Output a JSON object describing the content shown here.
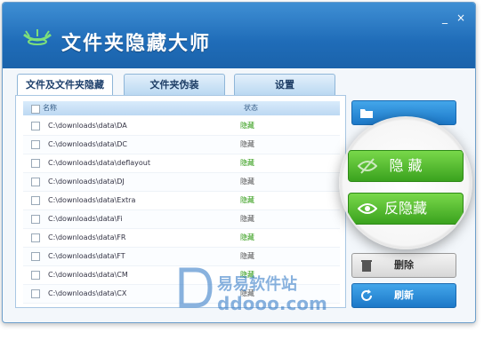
{
  "app": {
    "title": "文件夹隐藏大师",
    "minimize": "_",
    "close": "×"
  },
  "tabs": [
    "文件及文件夹隐藏",
    "文件夹伪装",
    "设置"
  ],
  "list": {
    "header": {
      "name": "名称",
      "status": "状态"
    },
    "rows": [
      {
        "path": "C:\\downloads\\data\\DA",
        "status": "隐藏"
      },
      {
        "path": "C:\\downloads\\data\\DC",
        "status": "隐藏"
      },
      {
        "path": "C:\\downloads\\data\\deflayout",
        "status": "隐藏"
      },
      {
        "path": "C:\\downloads\\data\\DJ",
        "status": "隐藏"
      },
      {
        "path": "C:\\downloads\\data\\Extra",
        "status": "隐藏"
      },
      {
        "path": "C:\\downloads\\data\\Fi",
        "status": "隐藏"
      },
      {
        "path": "C:\\downloads\\data\\FR",
        "status": "隐藏"
      },
      {
        "path": "C:\\downloads\\data\\FT",
        "status": "隐藏"
      },
      {
        "path": "C:\\downloads\\data\\CM",
        "status": "隐藏"
      },
      {
        "path": "C:\\downloads\\data\\CX",
        "status": "隐藏"
      }
    ]
  },
  "buttons": {
    "hide": "隐 藏",
    "unhide": "反隐藏",
    "delete": "删除",
    "refresh": "刷新"
  },
  "watermark": {
    "text": "易易软件站",
    "url": "ddooo.com"
  },
  "colors": {
    "titlebar": "#1f6cb8",
    "accent": "#1c78c8",
    "green": "#3aa21e",
    "status_green": "#2e9a12"
  }
}
